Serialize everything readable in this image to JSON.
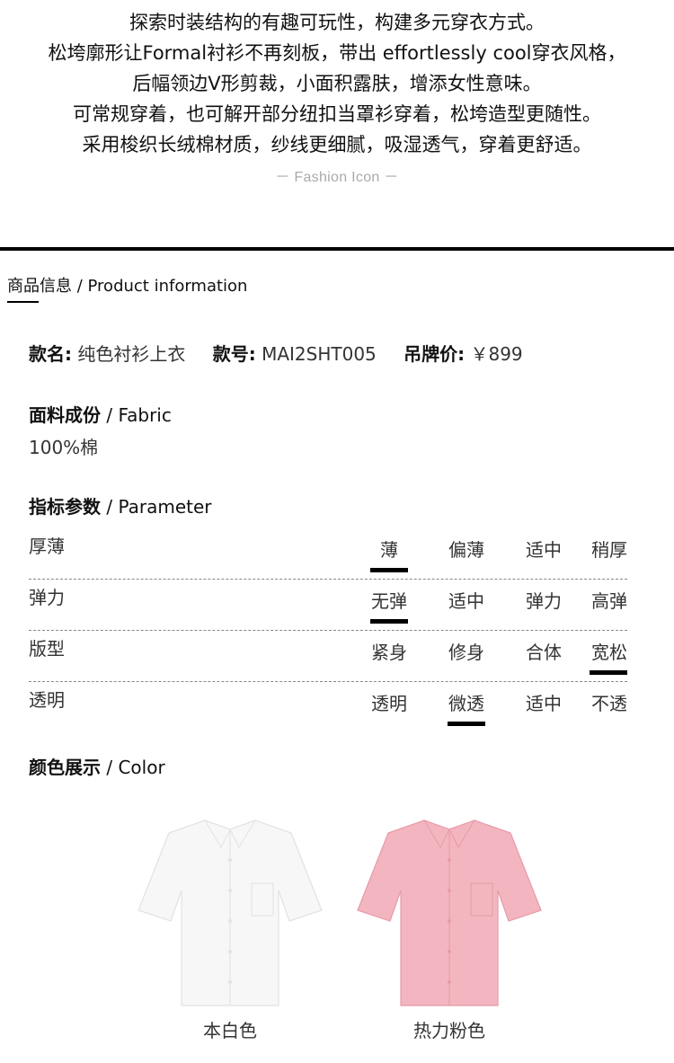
{
  "intro": {
    "lines": [
      "探索时装结构的有趣可玩性，构建多元穿衣方式。",
      "松垮廓形让Formal衬衫不再刻板，带出 effortlessly cool穿衣风格，",
      "后幅领边V形剪裁，小面积露肤，增添女性意味。",
      "可常规穿着，也可解开部分纽扣当罩衫穿着，松垮造型更随性。",
      "采用梭织长绒棉材质，纱线更细腻，吸湿透气，穿着更舒适。"
    ],
    "tagline": "－ Fashion Icon －"
  },
  "section": {
    "title": "商品信息 / Product information"
  },
  "meta": {
    "name_label": "款名:",
    "name_value": "纯色衬衫上衣",
    "code_label": "款号:",
    "code_value": "MAI2SHT005",
    "price_label": "吊牌价:",
    "price_value": "￥899"
  },
  "fabric": {
    "heading_zh": "面料成份",
    "heading_en": " / Fabric",
    "value": "100%棉"
  },
  "parameter": {
    "heading_zh": "指标参数",
    "heading_en": " / Parameter",
    "rows": [
      {
        "name": "厚薄",
        "options": [
          "薄",
          "偏薄",
          "适中",
          "稍厚"
        ],
        "selected": 0
      },
      {
        "name": "弹力",
        "options": [
          "无弹",
          "适中",
          "弹力",
          "高弹"
        ],
        "selected": 0
      },
      {
        "name": "版型",
        "options": [
          "紧身",
          "修身",
          "合体",
          "宽松"
        ],
        "selected": 3
      },
      {
        "name": "透明",
        "options": [
          "透明",
          "微透",
          "适中",
          "不透"
        ],
        "selected": 1
      }
    ]
  },
  "color": {
    "heading_zh": "颜色展示",
    "heading_en": " / Color",
    "items": [
      {
        "label": "本白色",
        "hex": "#f7f7f7",
        "shade": "#e2e2e2"
      },
      {
        "label": "热力粉色",
        "hex": "#f3b6c0",
        "shade": "#e79aa8"
      }
    ]
  }
}
